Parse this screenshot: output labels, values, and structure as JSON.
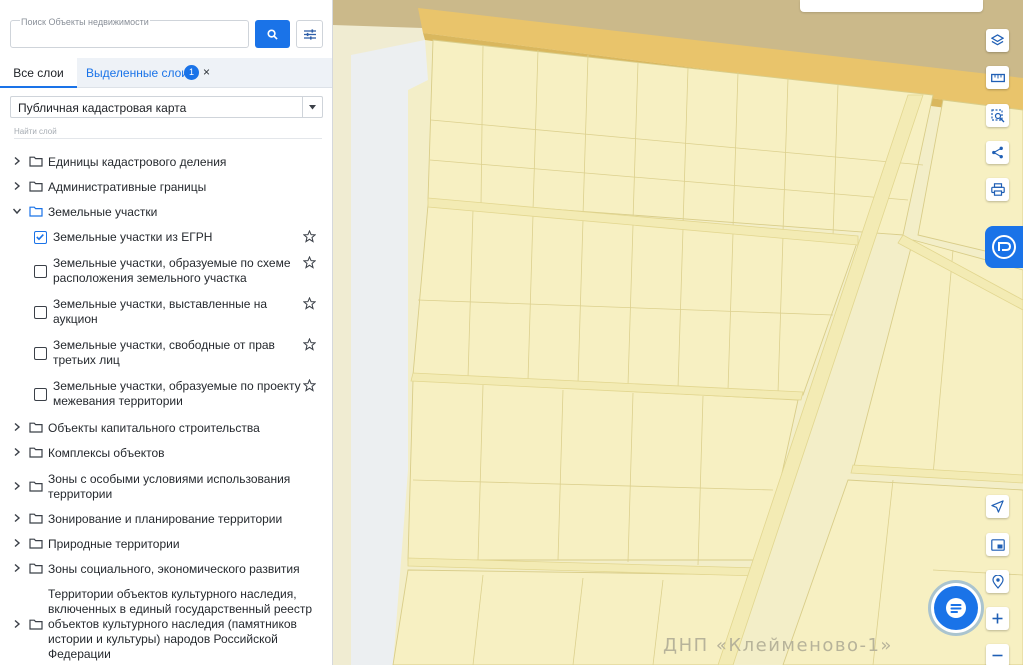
{
  "search": {
    "placeholder": "Поиск Объекты недвижимости",
    "value": ""
  },
  "tabs": {
    "all": "Все слои",
    "selected": "Выделенные слои",
    "selected_count": "1",
    "close": "×"
  },
  "basemap": {
    "selected": "Публичная кадастровая карта"
  },
  "layer_search": {
    "placeholder": "Найти слой"
  },
  "tree": [
    {
      "label": "Единицы кадастрового деления"
    },
    {
      "label": "Административные границы"
    },
    {
      "label": "Земельные участки"
    },
    {
      "label": "Объекты капитального строительства"
    },
    {
      "label": "Комплексы объектов"
    },
    {
      "label": "Зоны с особыми условиями использования территории"
    },
    {
      "label": "Зонирование и планирование территории"
    },
    {
      "label": "Природные территории"
    },
    {
      "label": "Зоны социального, экономического развития"
    },
    {
      "label": "Территории объектов культурного наследия, включенных в единый государственный реестр объектов культурного наследия (памятников истории и культуры) народов Российской Федерации"
    }
  ],
  "land_layers": [
    {
      "label": "Земельные участки из ЕГРН",
      "checked": true
    },
    {
      "label": "Земельные участки, образуемые по схеме расположения земельного участка",
      "checked": false
    },
    {
      "label": "Земельные участки, выставленные на аукцион",
      "checked": false
    },
    {
      "label": "Земельные участки, свободные от прав третьих лиц",
      "checked": false
    },
    {
      "label": "Земельные участки, образуемые по проекту межевания территории",
      "checked": false
    }
  ],
  "map": {
    "label": "ДНП «Клейменово-1»"
  },
  "icons": {
    "search": "search-icon",
    "filter": "sliders-icon",
    "layers": "layers-icon",
    "ruler": "ruler-icon",
    "select_area": "select-area-icon",
    "share": "share-icon",
    "print": "print-icon",
    "side_tab": "pos-logo-icon",
    "locate": "navigation-icon",
    "minimap": "picture-in-picture-icon",
    "geo": "geotag-icon",
    "chat": "chat-icon",
    "zoom_in": "plus-icon",
    "zoom_out": "minus-icon"
  },
  "colors": {
    "accent": "#1a73e8",
    "parcel_fill": "#f7f0c2",
    "parcel_line": "#d8cc87",
    "road": "#e9c46b"
  }
}
